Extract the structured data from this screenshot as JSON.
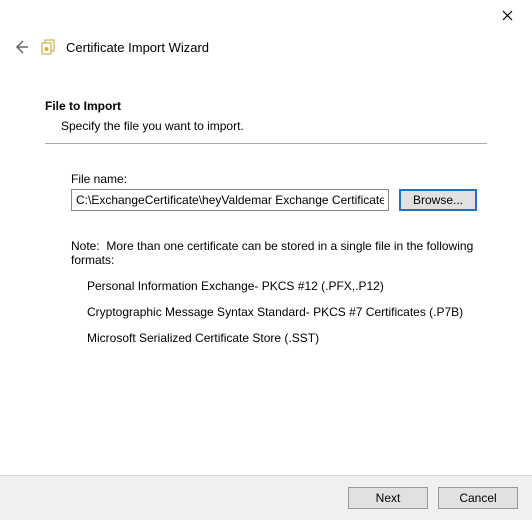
{
  "titlebar": {
    "close": "✕"
  },
  "header": {
    "title": "Certificate Import Wizard"
  },
  "main": {
    "heading": "File to Import",
    "subheading": "Specify the file you want to import.",
    "filename_label": "File name:",
    "filename_value": "C:\\ExchangeCertificate\\heyValdemar Exchange Certificate.cer",
    "browse_label": "Browse...",
    "note_prefix": "Note:",
    "note_text": "More than one certificate can be stored in a single file in the following formats:",
    "formats": [
      "Personal Information Exchange- PKCS #12 (.PFX,.P12)",
      "Cryptographic Message Syntax Standard- PKCS #7 Certificates (.P7B)",
      "Microsoft Serialized Certificate Store (.SST)"
    ]
  },
  "footer": {
    "next": "Next",
    "cancel": "Cancel"
  }
}
